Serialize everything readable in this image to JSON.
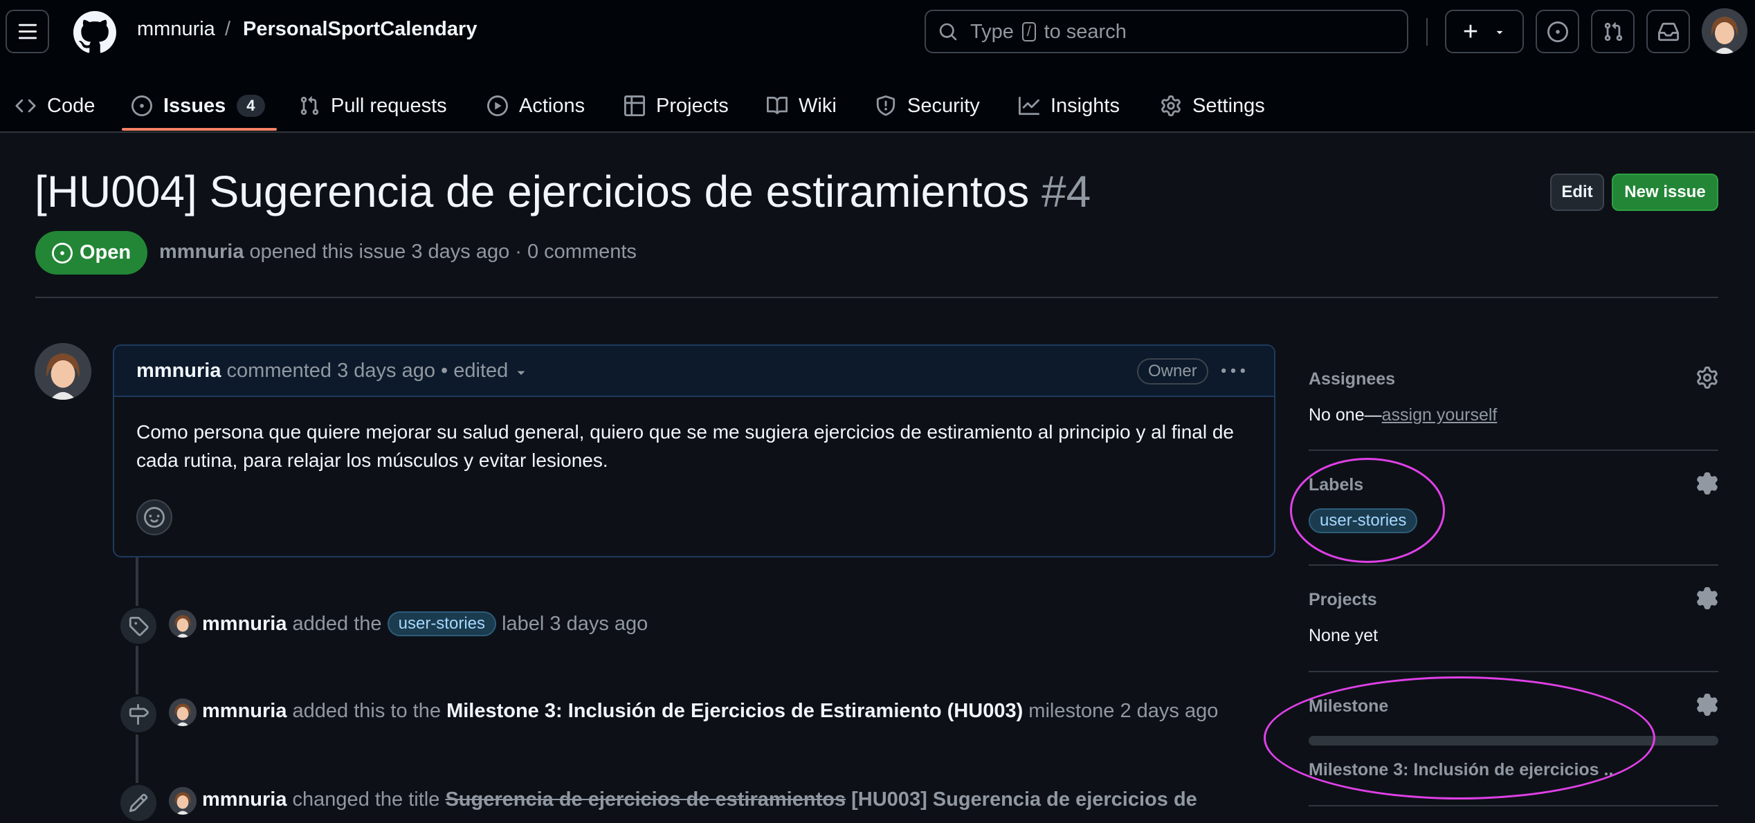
{
  "header": {
    "owner": "mmnuria",
    "separator": "/",
    "repo": "PersonalSportCalendary",
    "search_prefix": "Type",
    "search_key": "/",
    "search_suffix": "to search",
    "plus": "+"
  },
  "tabs": [
    {
      "label": "Code",
      "icon": "code-icon"
    },
    {
      "label": "Issues",
      "icon": "issue-opened-icon",
      "count": "4"
    },
    {
      "label": "Pull requests",
      "icon": "pull-request-icon"
    },
    {
      "label": "Actions",
      "icon": "play-icon"
    },
    {
      "label": "Projects",
      "icon": "table-icon"
    },
    {
      "label": "Wiki",
      "icon": "book-icon"
    },
    {
      "label": "Security",
      "icon": "shield-icon"
    },
    {
      "label": "Insights",
      "icon": "graph-icon"
    },
    {
      "label": "Settings",
      "icon": "gear-icon"
    }
  ],
  "issue": {
    "title": "[HU004] Sugerencia de ejercicios de estiramientos",
    "number": "#4",
    "state": "Open",
    "author": "mmnuria",
    "meta": "opened this issue 3 days ago · 0 comments",
    "edit_label": "Edit",
    "new_label": "New issue"
  },
  "comment": {
    "author": "mmnuria",
    "meta": "commented 3 days ago • edited",
    "role": "Owner",
    "body": "Como persona que quiere mejorar su salud general, quiero que se me sugiera ejercicios de estiramiento al principio y al final de cada rutina, para relajar los músculos y evitar lesiones."
  },
  "timeline": [
    {
      "icon": "tag-icon",
      "author": "mmnuria",
      "pre": "added the",
      "label": "user-stories",
      "post": "label 3 days ago"
    },
    {
      "icon": "milestone-icon",
      "author": "mmnuria",
      "pre": "added this to the",
      "milestone": "Milestone 3: Inclusión de Ejercicios de Estiramiento (HU003)",
      "post": "milestone 2 days ago"
    },
    {
      "icon": "pencil-icon",
      "author": "mmnuria",
      "pre": "changed the title",
      "old_title": "Sugerencia de ejercicios de estiramientos",
      "new_title": "[HU003] Sugerencia de ejercicios de"
    }
  ],
  "sidebar": {
    "assignees": {
      "heading": "Assignees",
      "value": "No one—",
      "link": "assign yourself"
    },
    "labels": {
      "heading": "Labels",
      "label": "user-stories"
    },
    "projects": {
      "heading": "Projects",
      "value": "None yet"
    },
    "milestone": {
      "heading": "Milestone",
      "value": "Milestone 3: Inclusión de ejercicios ..",
      "progress": 0
    }
  },
  "colors": {
    "accent": "#f78166",
    "open": "#238636",
    "highlight": "#e040e8"
  }
}
